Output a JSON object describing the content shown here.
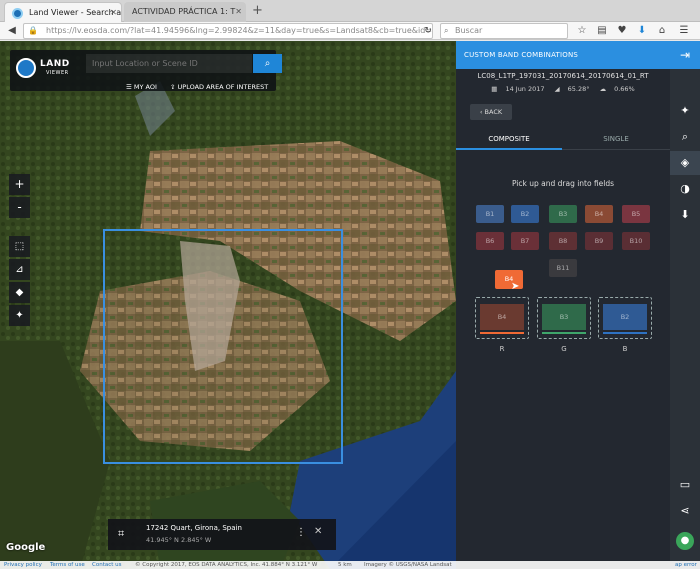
{
  "browser": {
    "tabs": [
      {
        "title": "Land Viewer - Search a"
      },
      {
        "title": "ACTIVIDAD PRÁCTICA 1: T"
      }
    ],
    "new_tab_glyph": "+",
    "url": "https://lv.eosda.com/?lat=41.94596&lng=2.99824&z=11&day=true&s=Landsat8&cb=true&id=",
    "search_placeholder": "Buscar",
    "icons": [
      "back-icon",
      "info-icon",
      "reload-icon",
      "star-icon",
      "reading-list-icon",
      "pocket-icon",
      "download-icon",
      "home-icon",
      "menu-icon"
    ]
  },
  "map": {
    "logo": {
      "word1": "LAND",
      "word2": "VIEWER"
    },
    "search_placeholder": "Input Location or Scene ID",
    "my_aoi": "MY AOI",
    "upload": "UPLOAD AREA OF INTEREST",
    "zoom_in": "+",
    "zoom_out": "-",
    "info": {
      "address": "17242 Quart, Girona, Spain",
      "coords": "41.945° N 2.845° W"
    },
    "google": "Google",
    "footer": {
      "privacy": "Privacy policy",
      "terms": "Terms of use",
      "contact": "Contact us",
      "copyright": "© Copyright 2017, EOS DATA ANALYTICS, Inc.",
      "cursor_coords": "41.884° N 3.121° W",
      "scale": "5 km",
      "imagery": "Imagery © USGS/NASA Landsat",
      "map_error": "ap error"
    }
  },
  "panel": {
    "header": "CUSTOM BAND COMBINATIONS",
    "scene_id": "LC08_L1TP_197031_20170614_20170614_01_RT",
    "date": "14 Jun 2017",
    "sun_angle": "65.28°",
    "cloud": "0.66%",
    "back": "BACK",
    "tab_composite": "COMPOSITE",
    "tab_single": "SINGLE",
    "hint": "Pick up and drag into fields",
    "bands_row1": [
      "B1",
      "B2",
      "B3",
      "B4",
      "B5"
    ],
    "bands_row2": [
      "B6",
      "B7",
      "B8",
      "B9",
      "B10"
    ],
    "band_b11": "B11",
    "dragging": "B4",
    "fields": [
      {
        "label": "R",
        "band": "B4"
      },
      {
        "label": "G",
        "band": "B3"
      },
      {
        "label": "B",
        "band": "B2"
      }
    ],
    "colors": {
      "accent": "#2b8fe0",
      "red_band": "#f06a35",
      "green_band": "#3fa66b",
      "blue_band": "#2e72c2"
    }
  }
}
